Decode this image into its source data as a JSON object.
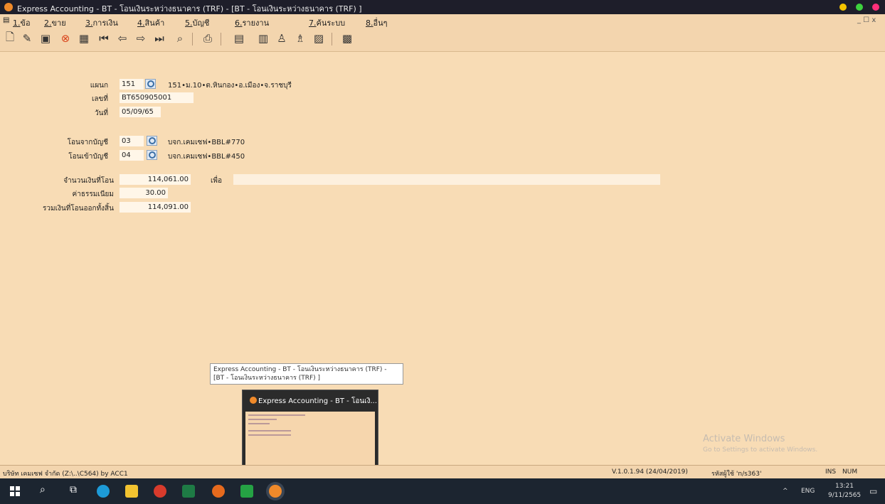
{
  "window": {
    "title": "Express Accounting - BT - โอนเงินระหว่างธนาคาร (TRF)   - [BT - โอนเงินระหว่างธนาคาร (TRF)  ]",
    "sys_buttons": "_ ☐ x"
  },
  "menu": [
    "1.ข้อ",
    "2.ขาย",
    "3.การเงิน",
    "4.สินค้า",
    "5.บัญชี",
    "6.รายงาน",
    "7.ค้นระบบ",
    "8.อื่นๆ"
  ],
  "colors": {
    "background": "#f8dcb5",
    "titlebar": "#1e1e2a",
    "taskbar": "#1c2530"
  },
  "form": {
    "branch_label": "แผนก",
    "branch_code": "151",
    "branch_desc": "151•ม.10•ต.หินกอง•อ.เมือง•จ.ราชบุรี",
    "doc_no_label": "เลขที่",
    "doc_no": "BT650905001",
    "date_label": "วันที่",
    "date": "05/09/65",
    "from_account_label": "โอนจากบัญชี",
    "from_account_code": "03",
    "from_account_desc": "บจก.เคมเซฟ•BBL#770",
    "to_account_label": "โอนเข้าบัญชี",
    "to_account_code": "04",
    "to_account_desc": "บจก.เคมเซฟ•BBL#450",
    "amount_label": "จำนวนเงินที่โอน",
    "amount": "114,061.00",
    "purpose_label": "เพื่อ",
    "purpose": "",
    "fee_label": "ค่าธรรมเนียม",
    "fee": "30.00",
    "total_label": "รวมเงินที่โอนออกทั้งสิ้น",
    "total": "114,091.00"
  },
  "tooltip": {
    "line1": "Express Accounting - BT - โอนเงินระหว่างธนาคาร (TRF)   -",
    "line2": "[BT - โอนเงินระหว่างธนาคาร (TRF)  ]"
  },
  "preview": {
    "title": "Express Accounting - BT - โอนเงิ..."
  },
  "status": {
    "company": "บริษัท เคมเซฟ จำกัด (Z:\\..\\C564) by ACC1",
    "version": "V.1.0.1.94 (24/04/2019)",
    "user": "รหัสผู้ใช้ 'n/s363'",
    "ins": "INS",
    "num": "NUM"
  },
  "watermark": {
    "line1": "Activate Windows",
    "line2": "Go to Settings to activate Windows."
  },
  "taskbar": {
    "lang": "ENG",
    "time": "13:21",
    "date": "9/11/2565"
  }
}
